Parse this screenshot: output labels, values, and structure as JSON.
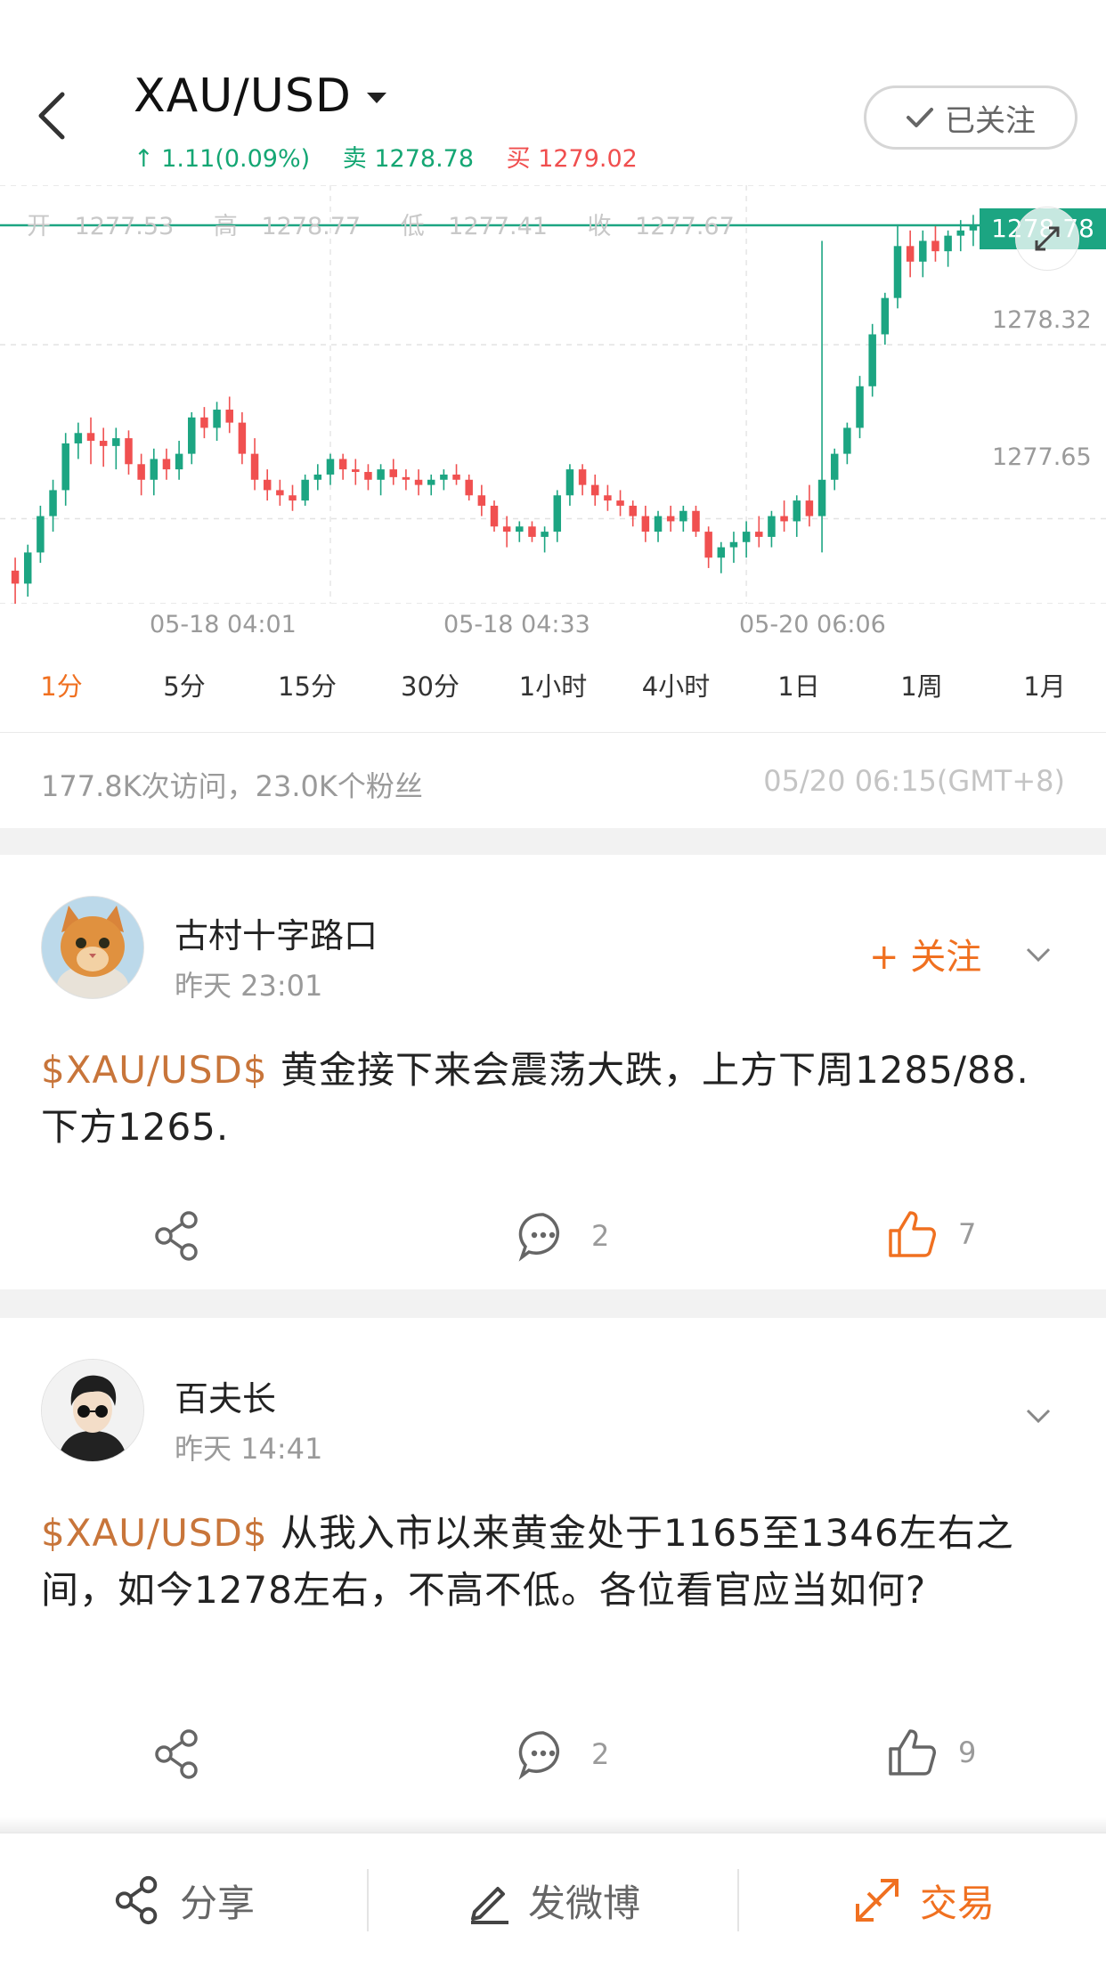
{
  "header": {
    "title": "XAU/USD",
    "change": "↑ 1.11(0.09%)",
    "sell_label": "卖",
    "sell_price": "1278.78",
    "buy_label": "买",
    "buy_price": "1279.02",
    "follow_state": "已关注"
  },
  "chart_data": {
    "type": "candlestick",
    "ohlc_summary": {
      "open_label": "开",
      "open": "1277.53",
      "high_label": "高",
      "high": "1278.77",
      "low_label": "低",
      "low": "1277.41",
      "close_label": "收",
      "close": "1277.67"
    },
    "current_price": "1278.78",
    "y_ticks": [
      "1278.32",
      "1277.65"
    ],
    "x_ticks": [
      "05-18 04:01",
      "05-18 04:33",
      "05-20 06:06"
    ],
    "ylim": [
      1277.35,
      1278.9
    ],
    "up_color": "#1ca582",
    "down_color": "#f05050",
    "candles": [
      [
        1277.45,
        1277.5,
        1277.32,
        1277.4
      ],
      [
        1277.4,
        1277.55,
        1277.35,
        1277.52
      ],
      [
        1277.52,
        1277.7,
        1277.48,
        1277.66
      ],
      [
        1277.66,
        1277.8,
        1277.6,
        1277.76
      ],
      [
        1277.76,
        1277.98,
        1277.7,
        1277.94
      ],
      [
        1277.94,
        1278.02,
        1277.88,
        1277.98
      ],
      [
        1277.98,
        1278.04,
        1277.86,
        1277.95
      ],
      [
        1277.95,
        1278.0,
        1277.85,
        1277.93
      ],
      [
        1277.93,
        1278.0,
        1277.84,
        1277.96
      ],
      [
        1277.96,
        1277.99,
        1277.82,
        1277.86
      ],
      [
        1277.86,
        1277.9,
        1277.74,
        1277.8
      ],
      [
        1277.8,
        1277.92,
        1277.74,
        1277.88
      ],
      [
        1277.88,
        1277.92,
        1277.8,
        1277.84
      ],
      [
        1277.84,
        1277.95,
        1277.8,
        1277.9
      ],
      [
        1277.9,
        1278.06,
        1277.86,
        1278.04
      ],
      [
        1278.04,
        1278.08,
        1277.96,
        1278.0
      ],
      [
        1278.0,
        1278.1,
        1277.95,
        1278.07
      ],
      [
        1278.07,
        1278.12,
        1277.98,
        1278.02
      ],
      [
        1278.02,
        1278.06,
        1277.86,
        1277.9
      ],
      [
        1277.9,
        1277.96,
        1277.76,
        1277.8
      ],
      [
        1277.8,
        1277.84,
        1277.72,
        1277.76
      ],
      [
        1277.76,
        1277.8,
        1277.7,
        1277.74
      ],
      [
        1277.74,
        1277.78,
        1277.68,
        1277.72
      ],
      [
        1277.72,
        1277.82,
        1277.7,
        1277.8
      ],
      [
        1277.8,
        1277.86,
        1277.76,
        1277.82
      ],
      [
        1277.82,
        1277.9,
        1277.78,
        1277.88
      ],
      [
        1277.88,
        1277.9,
        1277.8,
        1277.84
      ],
      [
        1277.84,
        1277.88,
        1277.78,
        1277.83
      ],
      [
        1277.83,
        1277.86,
        1277.76,
        1277.8
      ],
      [
        1277.8,
        1277.86,
        1277.74,
        1277.84
      ],
      [
        1277.84,
        1277.88,
        1277.78,
        1277.81
      ],
      [
        1277.81,
        1277.84,
        1277.76,
        1277.8
      ],
      [
        1277.8,
        1277.84,
        1277.74,
        1277.78
      ],
      [
        1277.78,
        1277.82,
        1277.74,
        1277.8
      ],
      [
        1277.8,
        1277.84,
        1277.76,
        1277.82
      ],
      [
        1277.82,
        1277.86,
        1277.78,
        1277.8
      ],
      [
        1277.8,
        1277.82,
        1277.72,
        1277.74
      ],
      [
        1277.74,
        1277.78,
        1277.66,
        1277.7
      ],
      [
        1277.7,
        1277.72,
        1277.6,
        1277.62
      ],
      [
        1277.62,
        1277.66,
        1277.54,
        1277.6
      ],
      [
        1277.6,
        1277.64,
        1277.56,
        1277.62
      ],
      [
        1277.62,
        1277.64,
        1277.56,
        1277.58
      ],
      [
        1277.58,
        1277.62,
        1277.52,
        1277.6
      ],
      [
        1277.6,
        1277.76,
        1277.56,
        1277.74
      ],
      [
        1277.74,
        1277.86,
        1277.7,
        1277.84
      ],
      [
        1277.84,
        1277.86,
        1277.74,
        1277.78
      ],
      [
        1277.78,
        1277.82,
        1277.7,
        1277.74
      ],
      [
        1277.74,
        1277.78,
        1277.68,
        1277.72
      ],
      [
        1277.72,
        1277.76,
        1277.66,
        1277.7
      ],
      [
        1277.7,
        1277.72,
        1277.62,
        1277.66
      ],
      [
        1277.66,
        1277.7,
        1277.56,
        1277.6
      ],
      [
        1277.6,
        1277.68,
        1277.56,
        1277.66
      ],
      [
        1277.66,
        1277.7,
        1277.6,
        1277.64
      ],
      [
        1277.64,
        1277.7,
        1277.6,
        1277.68
      ],
      [
        1277.68,
        1277.7,
        1277.58,
        1277.6
      ],
      [
        1277.6,
        1277.62,
        1277.46,
        1277.5
      ],
      [
        1277.5,
        1277.56,
        1277.44,
        1277.54
      ],
      [
        1277.54,
        1277.6,
        1277.48,
        1277.56
      ],
      [
        1277.56,
        1277.64,
        1277.5,
        1277.6
      ],
      [
        1277.6,
        1277.66,
        1277.54,
        1277.58
      ],
      [
        1277.58,
        1277.68,
        1277.54,
        1277.66
      ],
      [
        1277.66,
        1277.72,
        1277.6,
        1277.64
      ],
      [
        1277.64,
        1277.74,
        1277.58,
        1277.72
      ],
      [
        1277.72,
        1277.78,
        1277.62,
        1277.66
      ],
      [
        1277.66,
        1278.72,
        1277.52,
        1277.8
      ],
      [
        1277.8,
        1277.92,
        1277.76,
        1277.9
      ],
      [
        1277.9,
        1278.02,
        1277.86,
        1278.0
      ],
      [
        1278.0,
        1278.2,
        1277.96,
        1278.16
      ],
      [
        1278.16,
        1278.4,
        1278.12,
        1278.36
      ],
      [
        1278.36,
        1278.52,
        1278.32,
        1278.5
      ],
      [
        1278.5,
        1278.78,
        1278.46,
        1278.7
      ],
      [
        1278.7,
        1278.76,
        1278.58,
        1278.64
      ],
      [
        1278.64,
        1278.76,
        1278.58,
        1278.72
      ],
      [
        1278.72,
        1278.78,
        1278.64,
        1278.68
      ],
      [
        1278.68,
        1278.76,
        1278.62,
        1278.74
      ],
      [
        1278.74,
        1278.8,
        1278.68,
        1278.76
      ],
      [
        1278.76,
        1278.82,
        1278.7,
        1278.78
      ]
    ]
  },
  "timeframes": [
    "1分",
    "5分",
    "15分",
    "30分",
    "1小时",
    "4小时",
    "1日",
    "1周",
    "1月"
  ],
  "active_timeframe": "1分",
  "stats": {
    "visits": "177.8K",
    "visits_label": "次访问，",
    "fans": "23.0K",
    "fans_label": "个粉丝",
    "timestamp": "05/20 06:15(GMT+8)"
  },
  "posts": [
    {
      "username": "古村十字路口",
      "time": "昨天 23:01",
      "follow": "+ 关注",
      "tag": "$XAU/USD$",
      "text": " 黄金接下来会震荡大跌，上方下周1285/88.下方1265.",
      "comments": "2",
      "likes": "7"
    },
    {
      "username": "百夫长",
      "time": "昨天 14:41",
      "tag": "$XAU/USD$",
      "text": " 从我入市以来黄金处于1165至1346左右之间，如今1278左右，不高不低。各位看官应当如何?",
      "comments": "2",
      "likes": "9"
    }
  ],
  "bottom_bar": {
    "share": "分享",
    "post": "发微博",
    "trade": "交易"
  }
}
